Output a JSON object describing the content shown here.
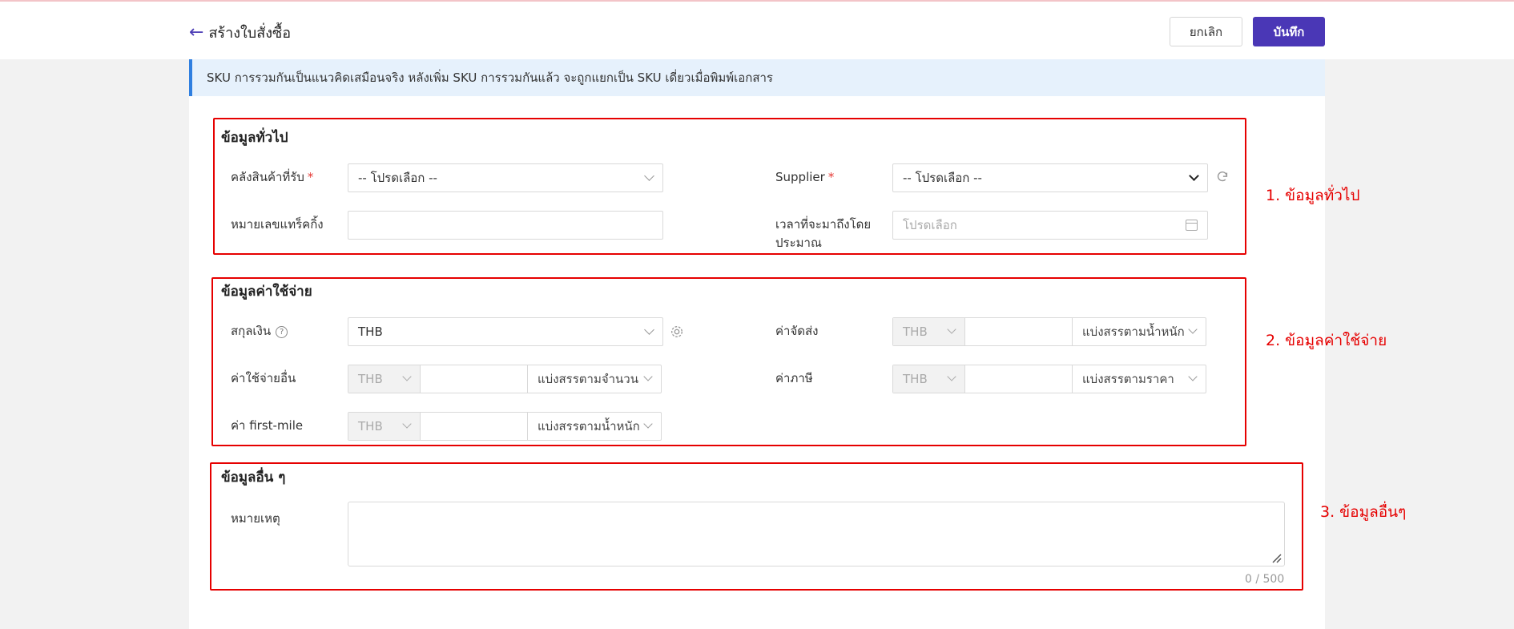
{
  "header": {
    "back_label": "สร้างใบสั่งซื้อ",
    "cancel_label": "ยกเลิก",
    "save_label": "บันทึก"
  },
  "notice": "SKU การรวมกันเป็นแนวคิดเสมือนจริง หลังเพิ่ม SKU การรวมกันแล้ว จะถูกแยกเป็น SKU เดี่ยวเมื่อพิมพ์เอกสาร",
  "general": {
    "title": "ข้อมูลทั่วไป",
    "warehouse_label": "คลังสินค้าที่รับ",
    "warehouse_value": "-- โปรดเลือก --",
    "supplier_label": "Supplier",
    "supplier_value": "-- โปรดเลือก --",
    "tracking_label": "หมายเลขแทร็คกิ้ง",
    "tracking_value": "",
    "eta_label_line1": "เวลาที่จะมาถึงโดย",
    "eta_label_line2": "ประมาณ",
    "eta_placeholder": "โปรดเลือก",
    "required_mark": "*"
  },
  "costs": {
    "title": "ข้อมูลค่าใช้จ่าย",
    "currency_label": "สกุลเงิน",
    "currency_value": "THB",
    "help_mark": "?",
    "shipping_label": "ค่าจัดส่ง",
    "shipping_currency": "THB",
    "shipping_alloc": "แบ่งสรรตามน้ำหนัก",
    "other_label": "ค่าใช้จ่ายอื่น",
    "other_currency": "THB",
    "other_alloc": "แบ่งสรรตามจำนวน",
    "tax_label": "ค่าภาษี",
    "tax_currency": "THB",
    "tax_alloc": "แบ่งสรรตามราคา",
    "firstmile_label": "ค่า first-mile",
    "firstmile_currency": "THB",
    "firstmile_alloc": "แบ่งสรรตามน้ำหนัก"
  },
  "other": {
    "title": "ข้อมูลอื่น ๆ",
    "remark_label": "หมายเหตุ",
    "remark_value": "",
    "counter": "0 / 500"
  },
  "annotations": {
    "a1": "1. ข้อมูลทั่วไป",
    "a2": "2. ข้อมูลค่าใช้จ่าย",
    "a3": "3. ข้อมูลอื่นๆ"
  }
}
